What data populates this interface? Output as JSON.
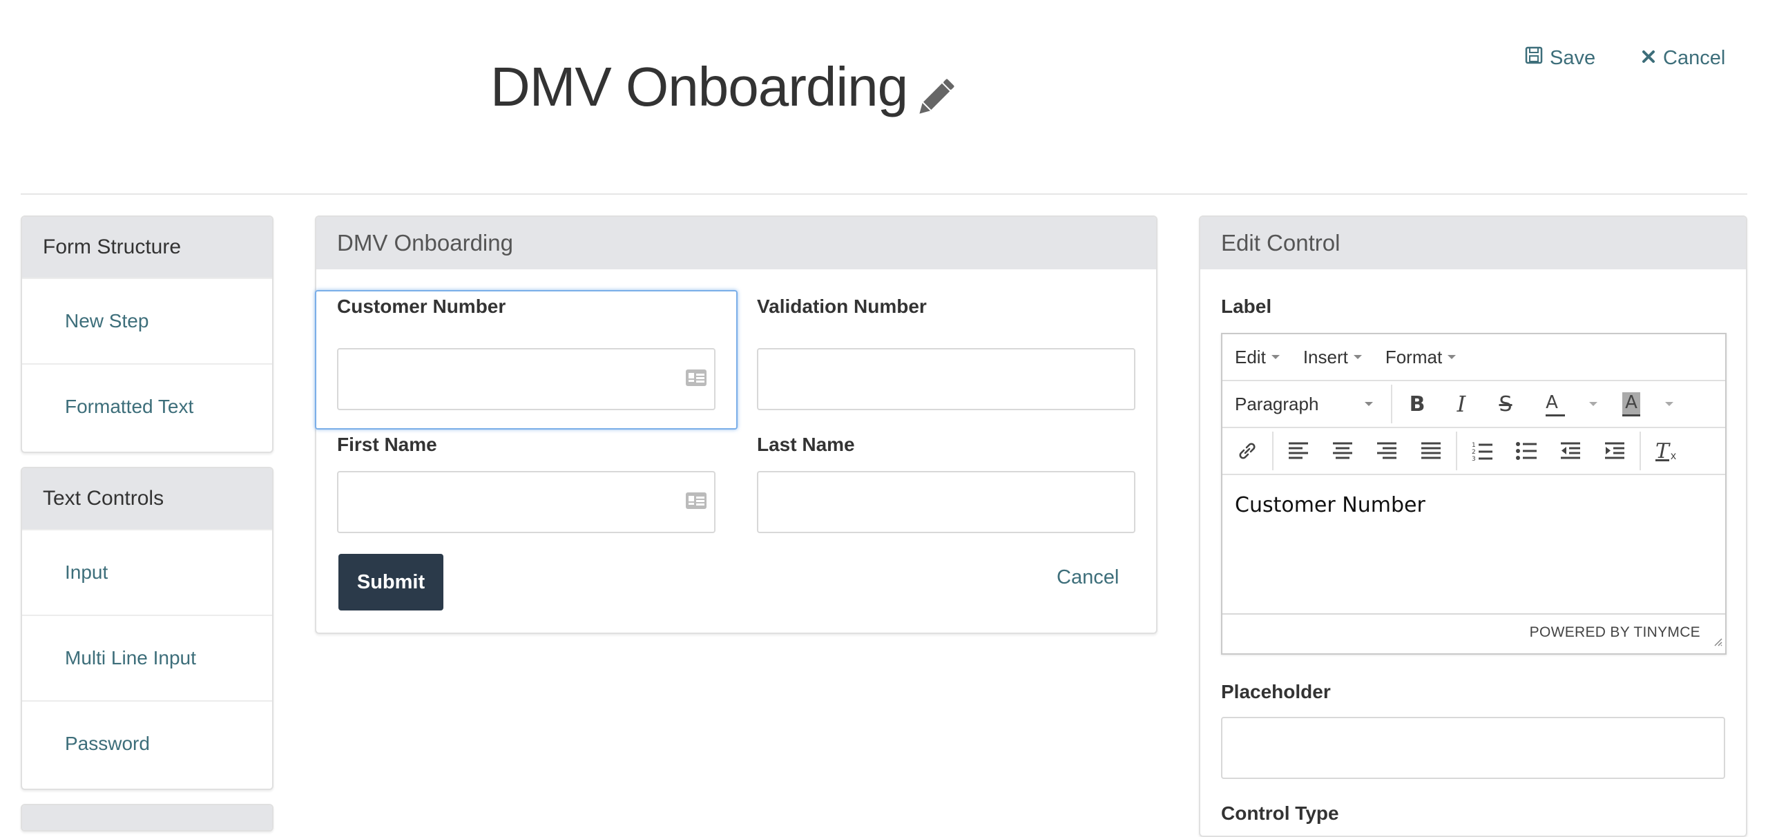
{
  "header": {
    "title": "DMV Onboarding",
    "save_label": "Save",
    "cancel_label": "Cancel"
  },
  "sidebar": {
    "sections": [
      {
        "title": "Form Structure",
        "items": [
          {
            "label": "New Step"
          },
          {
            "label": "Formatted Text"
          }
        ]
      },
      {
        "title": "Text Controls",
        "items": [
          {
            "label": "Input"
          },
          {
            "label": "Multi Line Input"
          },
          {
            "label": "Password"
          }
        ]
      }
    ]
  },
  "form": {
    "title": "DMV Onboarding",
    "fields": [
      {
        "label": "Customer Number",
        "value": ""
      },
      {
        "label": "Validation Number",
        "value": ""
      },
      {
        "label": "First Name",
        "value": ""
      },
      {
        "label": "Last Name",
        "value": ""
      }
    ],
    "submit_label": "Submit",
    "cancel_label": "Cancel"
  },
  "edit_control": {
    "title": "Edit Control",
    "label_heading": "Label",
    "menus": [
      {
        "label": "Edit"
      },
      {
        "label": "Insert"
      },
      {
        "label": "Format"
      }
    ],
    "block_format": "Paragraph",
    "content": "Customer Number",
    "powered_by": "POWERED BY TINYMCE",
    "placeholder_heading": "Placeholder",
    "placeholder_value": "",
    "next_heading": "Control Type"
  },
  "colors": {
    "link": "#3d6e7a",
    "button": "#2b3a4a",
    "panel_header": "#e4e5e8",
    "selection": "#7aaee8"
  },
  "icons": {
    "title_edit": "pencil-icon",
    "save": "floppy-disk-icon",
    "cancel": "x-icon",
    "field_card": "id-card-icon"
  }
}
